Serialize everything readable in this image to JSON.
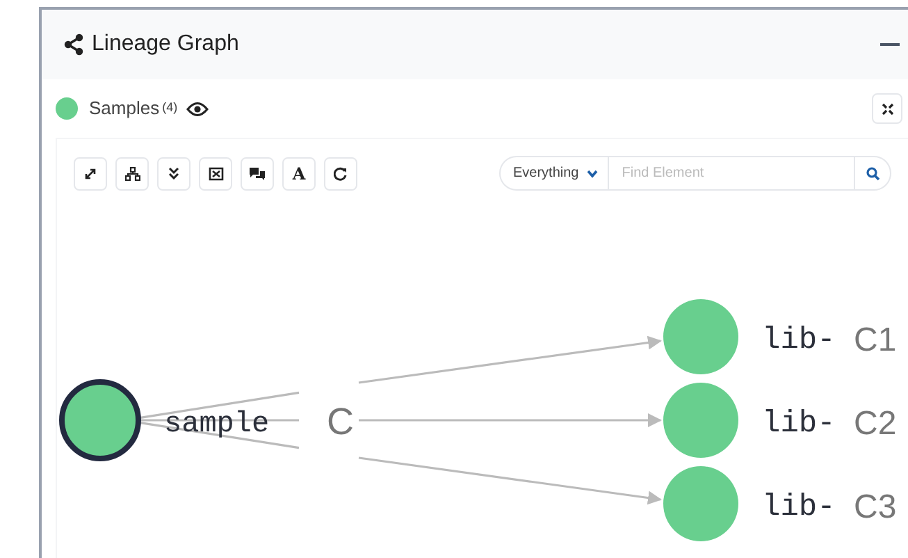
{
  "panel": {
    "title": "Lineage Graph"
  },
  "legend": {
    "label": "Samples",
    "count": "(4)",
    "color": "#68cf8e"
  },
  "toolbar": {
    "font_button": "A"
  },
  "search": {
    "scope": "Everything",
    "placeholder": "Find Element"
  },
  "graph": {
    "nodes": [
      {
        "name": "sample",
        "tag": "C",
        "selected": true
      },
      {
        "name": "lib-",
        "tag": "C1",
        "selected": false
      },
      {
        "name": "lib-",
        "tag": "C2",
        "selected": false
      },
      {
        "name": "lib-",
        "tag": "C3",
        "selected": false
      }
    ]
  }
}
